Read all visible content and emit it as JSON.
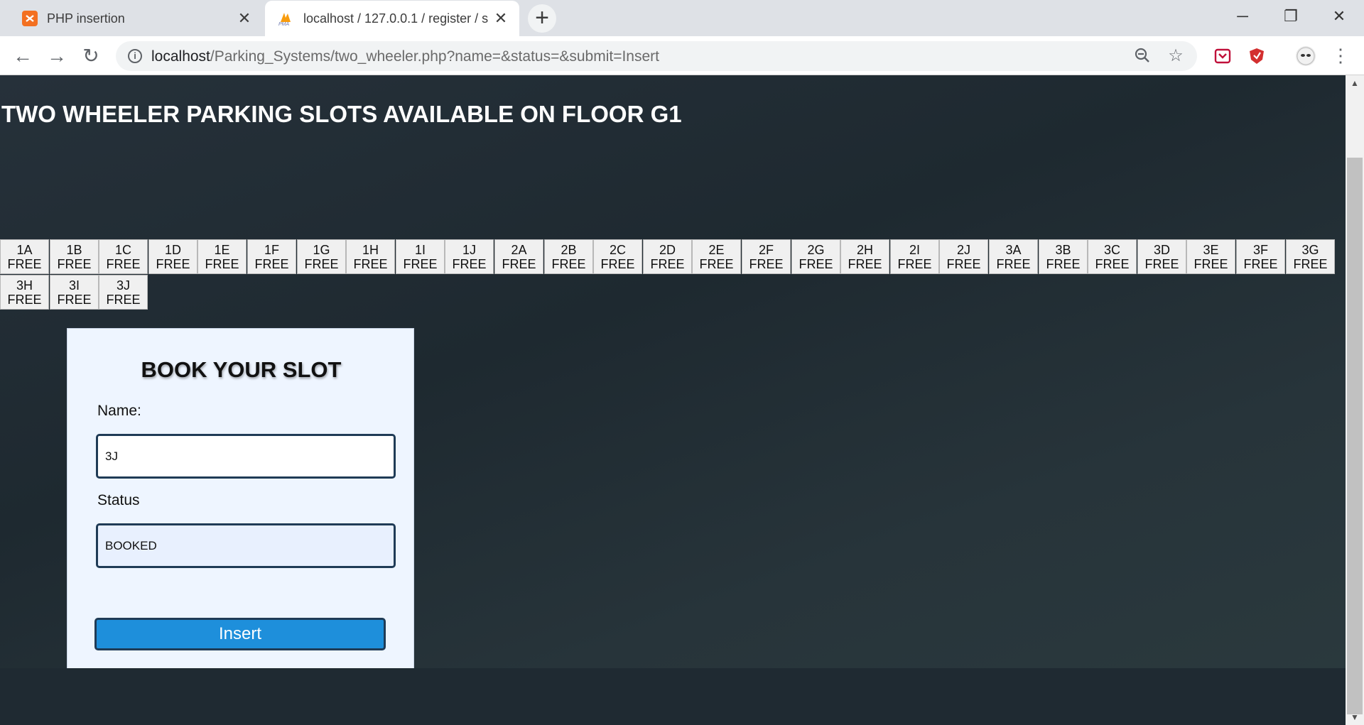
{
  "browser": {
    "tabs": [
      {
        "title": "PHP insertion",
        "icon": "xampp-icon",
        "active": false
      },
      {
        "title": "localhost / 127.0.0.1 / register / s",
        "icon": "phpmyadmin-icon",
        "active": true
      }
    ],
    "url_host": "localhost",
    "url_path": "/Parking_Systems/two_wheeler.php?name=&status=&submit=Insert",
    "window_controls": {
      "minimize": "─",
      "restore": "❐",
      "close": "✕"
    }
  },
  "page": {
    "title": "TWO WHEELER PARKING SLOTS AVAILABLE ON FLOOR G1",
    "slots": [
      {
        "id": "1A",
        "status": "FREE"
      },
      {
        "id": "1B",
        "status": "FREE"
      },
      {
        "id": "1C",
        "status": "FREE"
      },
      {
        "id": "1D",
        "status": "FREE"
      },
      {
        "id": "1E",
        "status": "FREE"
      },
      {
        "id": "1F",
        "status": "FREE"
      },
      {
        "id": "1G",
        "status": "FREE"
      },
      {
        "id": "1H",
        "status": "FREE"
      },
      {
        "id": "1I",
        "status": "FREE"
      },
      {
        "id": "1J",
        "status": "FREE"
      },
      {
        "id": "2A",
        "status": "FREE"
      },
      {
        "id": "2B",
        "status": "FREE"
      },
      {
        "id": "2C",
        "status": "FREE"
      },
      {
        "id": "2D",
        "status": "FREE"
      },
      {
        "id": "2E",
        "status": "FREE"
      },
      {
        "id": "2F",
        "status": "FREE"
      },
      {
        "id": "2G",
        "status": "FREE"
      },
      {
        "id": "2H",
        "status": "FREE"
      },
      {
        "id": "2I",
        "status": "FREE"
      },
      {
        "id": "2J",
        "status": "FREE"
      },
      {
        "id": "3A",
        "status": "FREE"
      },
      {
        "id": "3B",
        "status": "FREE"
      },
      {
        "id": "3C",
        "status": "FREE"
      },
      {
        "id": "3D",
        "status": "FREE"
      },
      {
        "id": "3E",
        "status": "FREE"
      },
      {
        "id": "3F",
        "status": "FREE"
      },
      {
        "id": "3G",
        "status": "FREE"
      },
      {
        "id": "3H",
        "status": "FREE"
      },
      {
        "id": "3I",
        "status": "FREE"
      },
      {
        "id": "3J",
        "status": "FREE"
      }
    ],
    "form": {
      "title": "BOOK YOUR SLOT",
      "name_label": "Name:",
      "name_value": "3J",
      "status_label": "Status",
      "status_value": "BOOKED",
      "submit_label": "Insert"
    }
  }
}
